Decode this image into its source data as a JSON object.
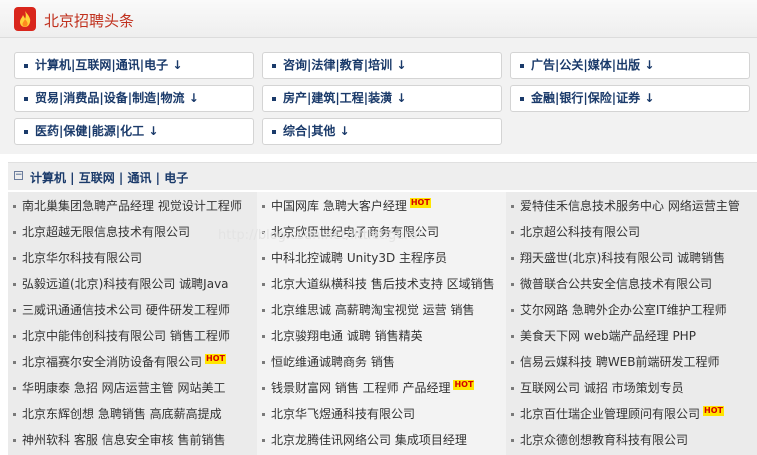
{
  "header": {
    "title": "北京招聘头条",
    "icon": "flame-icon",
    "brand_color": "#c0311e"
  },
  "categories": [
    "计算机|互联网|通讯|电子 ↓",
    "咨询|法律|教育|培训 ↓",
    "广告|公关|媒体|出版 ↓",
    "贸易|消费品|设备|制造|物流 ↓",
    "房产|建筑|工程|装潢 ↓",
    "金融|银行|保险|证券 ↓",
    "医药|保健|能源|化工 ↓",
    "综合|其他 ↓"
  ],
  "section": {
    "collapse_symbol": "−",
    "label": "计算机  |  互联网  |  通讯  |  电子"
  },
  "listings": {
    "col0": [
      {
        "text": "南北巢集团急聘产品经理 视觉设计工程师",
        "hot": false
      },
      {
        "text": "北京超越无限信息技术有限公司",
        "hot": false
      },
      {
        "text": "北京华尔科技有限公司",
        "hot": false
      },
      {
        "text": "弘毅远道(北京)科技有限公司 诚聘Java",
        "hot": false
      },
      {
        "text": "三威讯通通信技术公司 硬件研发工程师",
        "hot": false
      },
      {
        "text": "北京中能伟创科技有限公司 销售工程师",
        "hot": false
      },
      {
        "text": "北京福赛尔安全消防设备有限公司",
        "hot": true
      },
      {
        "text": "华明康泰 急招 网店运营主管 网站美工",
        "hot": false
      },
      {
        "text": "北京东辉创想 急聘销售 高底薪高提成",
        "hot": false
      },
      {
        "text": "神州软科 客服 信息安全审核 售前销售",
        "hot": false
      }
    ],
    "col1": [
      {
        "text": "中国网库 急聘大客户经理",
        "hot": true
      },
      {
        "text": "北京欣臣世纪电子商务有限公司",
        "hot": false
      },
      {
        "text": "中科北控诚聘 Unity3D 主程序员",
        "hot": false
      },
      {
        "text": "北京大道纵横科技 售后技术支持 区域销售",
        "hot": false
      },
      {
        "text": "北京维思诚 高薪聘淘宝视觉 运营 销售",
        "hot": false
      },
      {
        "text": "北京骏翔电通 诚聘 销售精英",
        "hot": false
      },
      {
        "text": "恒屹维通诚聘商务 销售",
        "hot": false
      },
      {
        "text": "钱景财富网 销售 工程师 产品经理",
        "hot": true
      },
      {
        "text": "北京华飞煜通科技有限公司",
        "hot": false
      },
      {
        "text": "北京龙腾佳讯网络公司 集成项目经理",
        "hot": false
      }
    ],
    "col2": [
      {
        "text": "爱特佳禾信息技术服务中心 网络运营主管",
        "hot": false
      },
      {
        "text": "北京超公科技有限公司",
        "hot": false
      },
      {
        "text": "翔天盛世(北京)科技有限公司 诚聘销售",
        "hot": false
      },
      {
        "text": "微普联合公共安全信息技术有限公司",
        "hot": false
      },
      {
        "text": "艾尔网路 急聘外企办公室IT维护工程师",
        "hot": false
      },
      {
        "text": "美食天下网 web端产品经理 PHP",
        "hot": false
      },
      {
        "text": "信易云媒科技 聘WEB前端研发工程师",
        "hot": false
      },
      {
        "text": "互联网公司 诚招 市场策划专员",
        "hot": false
      },
      {
        "text": "北京百仕瑞企业管理顾问有限公司",
        "hot": true
      },
      {
        "text": "北京众德创想教育科技有限公司",
        "hot": false
      }
    ],
    "hot_label": "HOT"
  },
  "watermark": "http://blog.csdn.net/littletigerat"
}
